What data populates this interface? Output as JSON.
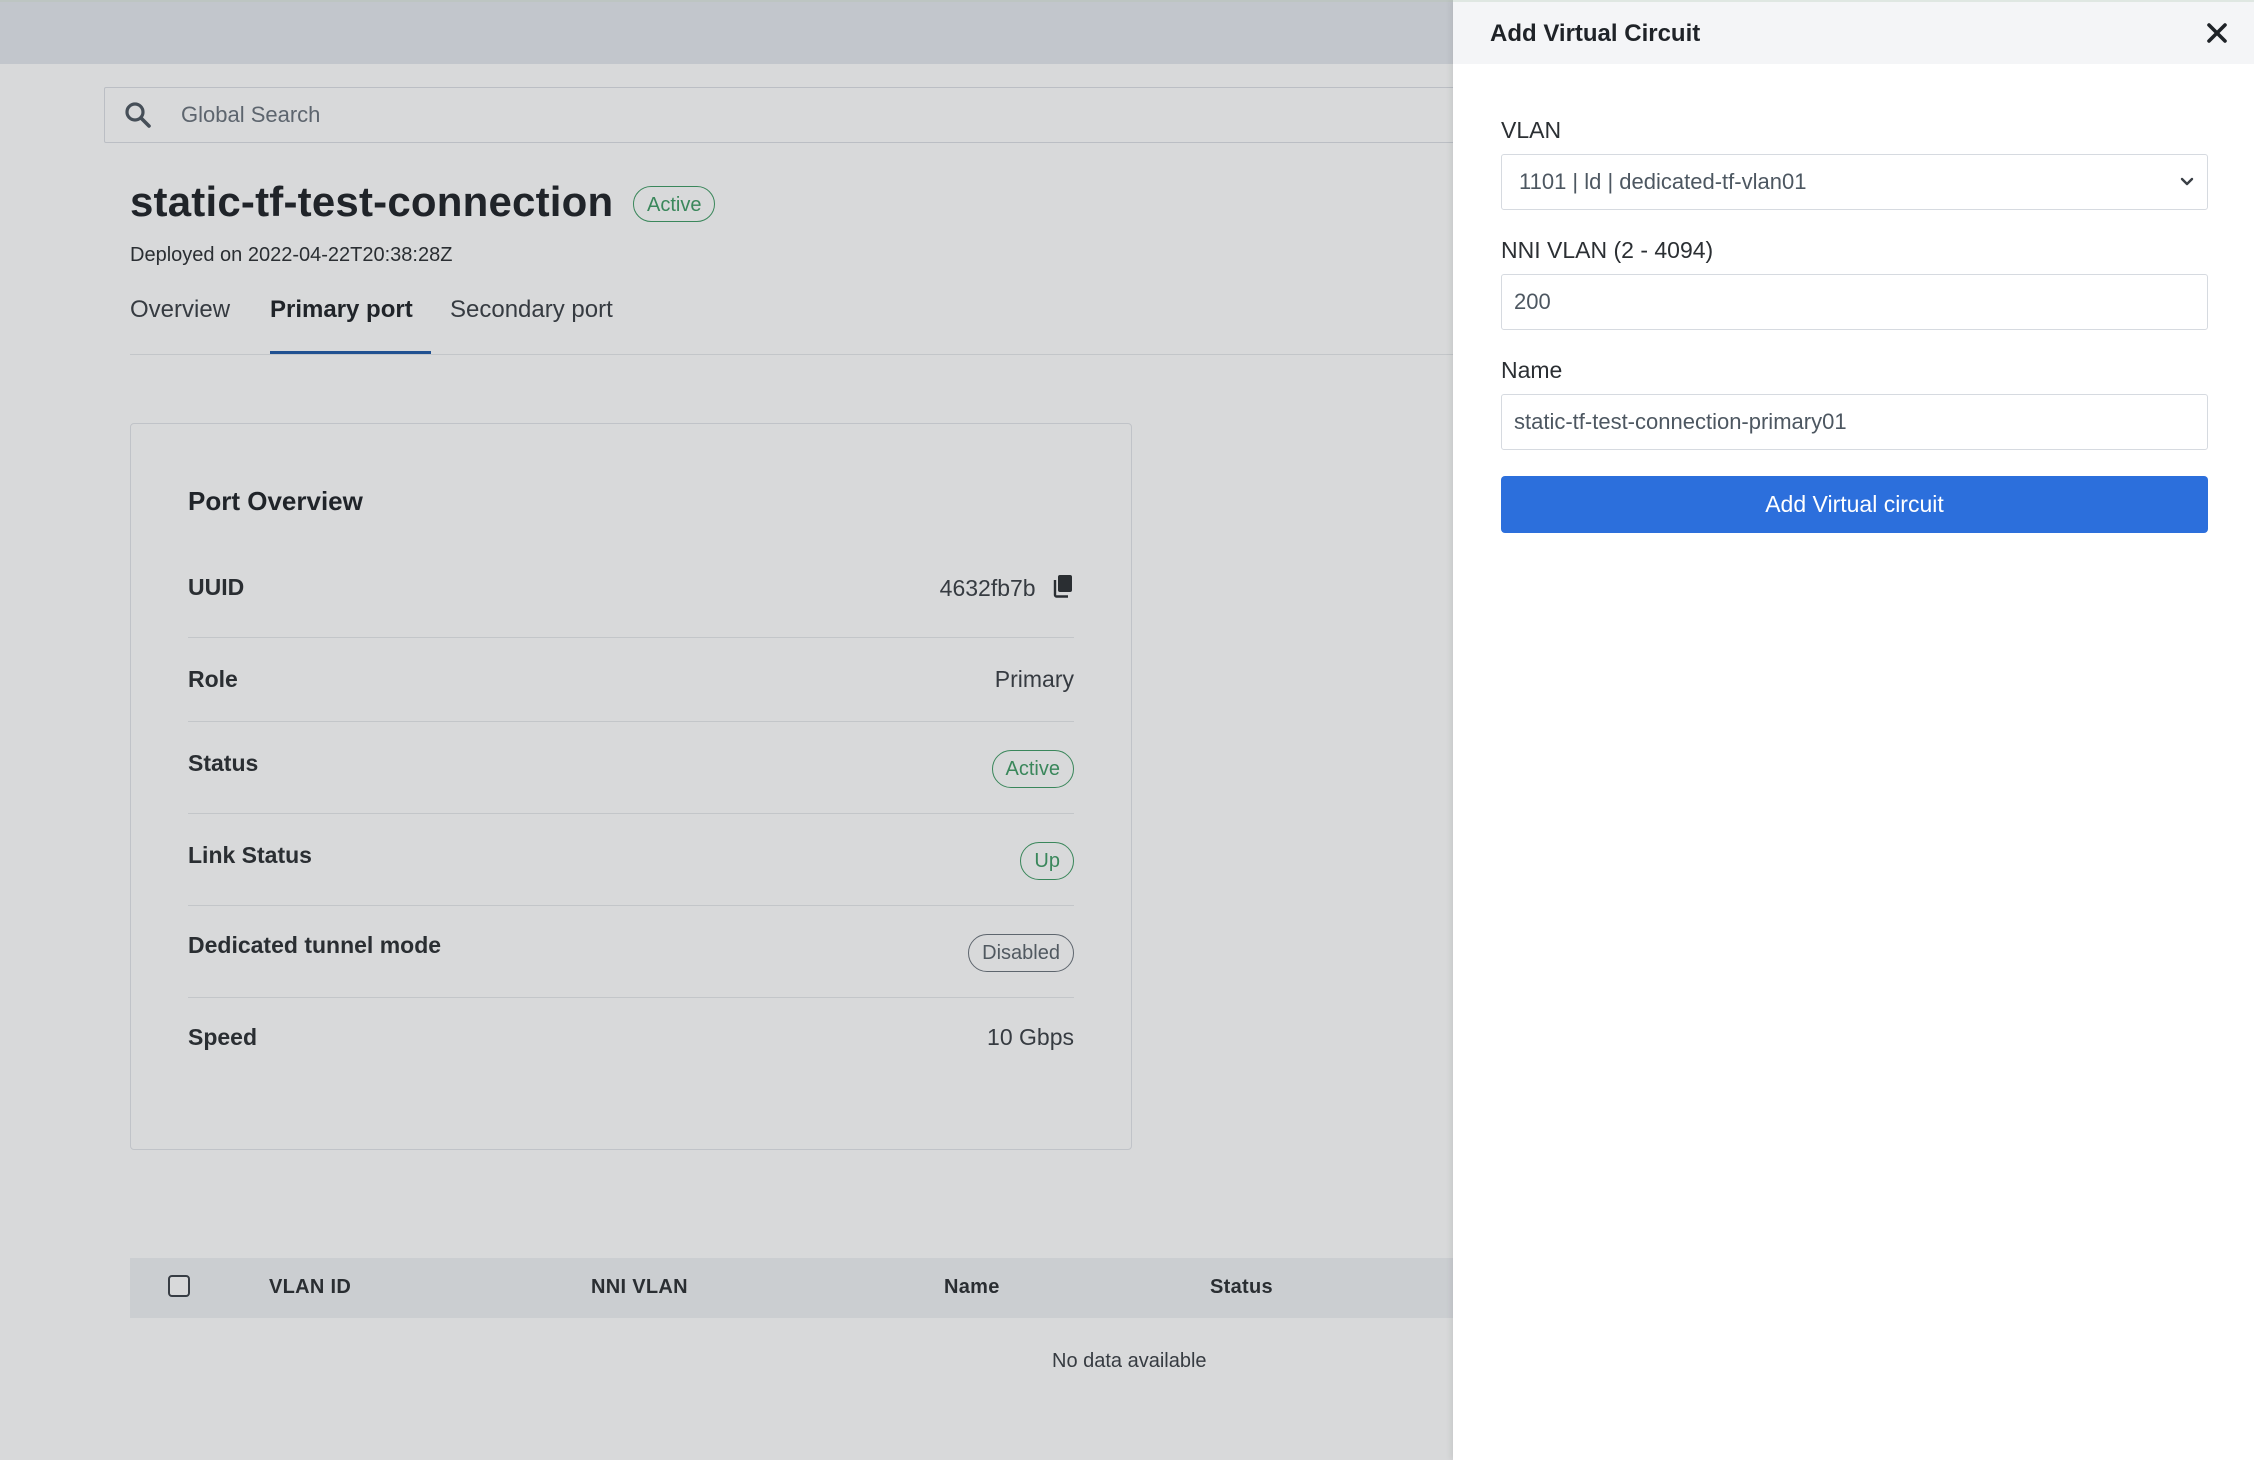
{
  "search": {
    "placeholder": "Global Search"
  },
  "connection": {
    "title": "static-tf-test-connection",
    "status_badge": "Active",
    "deployed": "Deployed on 2022-04-22T20:38:28Z"
  },
  "tabs": [
    {
      "label": "Overview",
      "active": false
    },
    {
      "label": "Primary port",
      "active": true
    },
    {
      "label": "Secondary port",
      "active": false
    }
  ],
  "port_overview": {
    "title": "Port Overview",
    "rows": [
      {
        "label": "UUID",
        "value": "4632fb7b",
        "icon": "copy-icon"
      },
      {
        "label": "Role",
        "value": "Primary"
      },
      {
        "label": "Status",
        "value": "Active",
        "style": "badge-green"
      },
      {
        "label": "Link Status",
        "value": "Up",
        "style": "badge-green"
      },
      {
        "label": "Dedicated tunnel mode",
        "value": "Disabled",
        "style": "badge-grey"
      },
      {
        "label": "Speed",
        "value": "10 Gbps"
      }
    ]
  },
  "table": {
    "columns": [
      "VLAN ID",
      "NNI VLAN",
      "Name",
      "Status"
    ],
    "empty_message": "No data available"
  },
  "panel": {
    "title": "Add Virtual Circuit",
    "vlan": {
      "label": "VLAN",
      "selected": "1101 | ld | dedicated-tf-vlan01"
    },
    "nni_vlan": {
      "label": "NNI VLAN (2 - 4094)",
      "value": "200"
    },
    "name": {
      "label": "Name",
      "value": "static-tf-test-connection-primary01"
    },
    "submit_label": "Add Virtual circuit"
  },
  "colors": {
    "accent": "#2c6fdc",
    "tab_underline": "#1f5aa6",
    "status_green": "#3f9b64",
    "status_grey": "#6b737c"
  }
}
